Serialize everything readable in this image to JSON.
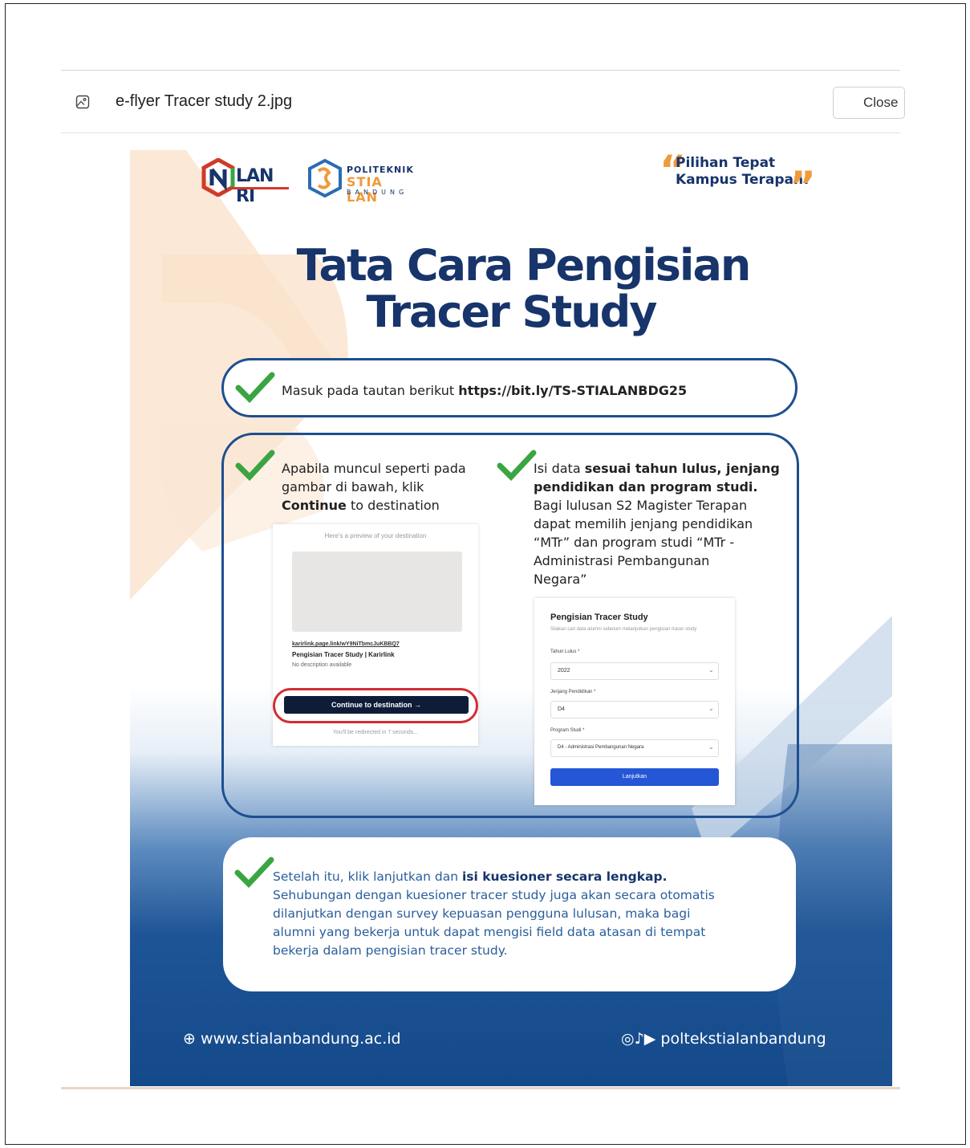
{
  "viewer": {
    "file_name": "e-flyer Tracer study 2.jpg",
    "close_label": "Close",
    "image_icon": "image-icon"
  },
  "flyer": {
    "logo_lan": "LAN RI",
    "logo_stia_top": "POLITEKNIK",
    "logo_stia_mid": "STIA LAN",
    "logo_stia_bottom": "BANDUNG",
    "tagline_line1": "Pilihan Tepat",
    "tagline_line2": "Kampus Terapan!",
    "title_line1": "Tata Cara Pengisian",
    "title_line2": "Tracer Study",
    "step1_text": "Masuk pada tautan berikut",
    "step1_link": "https://bit.ly/TS-STIALANBDG25",
    "step2_line1": "Apabila muncul seperti pada",
    "step2_line2": "gambar di bawah, klik",
    "step2_bold": "Continue",
    "step2_rest": "to destination",
    "step3_lead": "Isi data",
    "step3_bold1": "sesuai tahun lulus, jenjang",
    "step3_bold2": "pendidikan dan program studi.",
    "step3_l1": "Bagi lulusan S2 Magister Terapan",
    "step3_l2": "dapat memilih jenjang pendidikan",
    "step3_l3": "“MTr” dan program studi “MTr -",
    "step3_l4": "Administrasi Pembangunan",
    "step3_l5": "Negara”",
    "step4_lead": "Setelah itu, klik lanjutkan dan",
    "step4_bold": "isi kuesioner secara lengkap.",
    "step4_l1": "Sehubungan dengan kuesioner tracer study juga akan secara otomatis",
    "step4_l2": "dilanjutkan dengan survey kepuasan pengguna lulusan, maka bagi",
    "step4_l3": "alumni yang bekerja untuk dapat mengisi field data atasan di tempat",
    "step4_l4": "bekerja dalam pengisian tracer study.",
    "footer_web": "www.stialanbandung.ac.id",
    "footer_social": "poltekstialanbandung"
  },
  "preview_shot": {
    "header": "Here's a preview of your destination",
    "link": "karirlink.page.link/wY9NiTbmcJuKBBQ7",
    "title": "Pengisian Tracer Study | Karirlink",
    "desc": "No description available",
    "button": "Continue to destination →",
    "footer": "You'll be redirected in 7 seconds..."
  },
  "form_shot": {
    "title": "Pengisian Tracer Study",
    "subtitle": "Silakan cari data alumni sebelum melanjutkan pengisian tracer study",
    "field1_label": "Tahun Lulus *",
    "field1_value": "2022",
    "field2_label": "Jenjang Pendidikan *",
    "field2_value": "D4",
    "field3_label": "Program Studi *",
    "field3_value": "D4 - Administrasi Pembangunan Negara",
    "button": "Lanjutkan"
  },
  "colors": {
    "navy": "#17346b",
    "orange": "#f09a3a",
    "green_check": "#3aa541",
    "card_border": "#1d4f8f"
  }
}
